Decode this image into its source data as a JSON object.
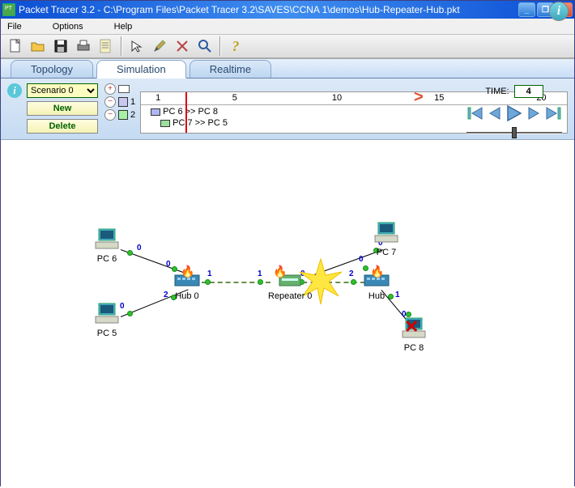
{
  "window": {
    "title": "Packet Tracer 3.2 - C:\\Program Files\\Packet Tracer 3.2\\SAVES\\CCNA 1\\demos\\Hub-Repeater-Hub.pkt"
  },
  "menu": {
    "file": "File",
    "options": "Options",
    "help": "Help"
  },
  "tabs": {
    "topology": "Topology",
    "simulation": "Simulation",
    "realtime": "Realtime"
  },
  "scenario": {
    "selected": "Scenario 0",
    "new_label": "New",
    "delete_label": "Delete",
    "legend": [
      {
        "idx": "1",
        "color": "#c7c7f0"
      },
      {
        "idx": "2",
        "color": "#a6f0a6"
      }
    ]
  },
  "timeline": {
    "ticks": [
      "1",
      "5",
      "10",
      "15",
      "20"
    ],
    "entries": [
      {
        "color": "blue",
        "text": "PC 6 >> PC 8"
      },
      {
        "color": "green",
        "text": "PC 7 >> PC 5"
      }
    ]
  },
  "time": {
    "label": "TIME:",
    "value": "4"
  },
  "devices": {
    "pc6": "PC 6",
    "pc5": "PC 5",
    "pc7": "PC 7",
    "pc8": "PC 8",
    "hub0": "Hub 0",
    "hub1": "Hub",
    "rep0": "Repeater 0"
  },
  "ports": {
    "p0": "0",
    "p1": "1",
    "p2": "2"
  }
}
